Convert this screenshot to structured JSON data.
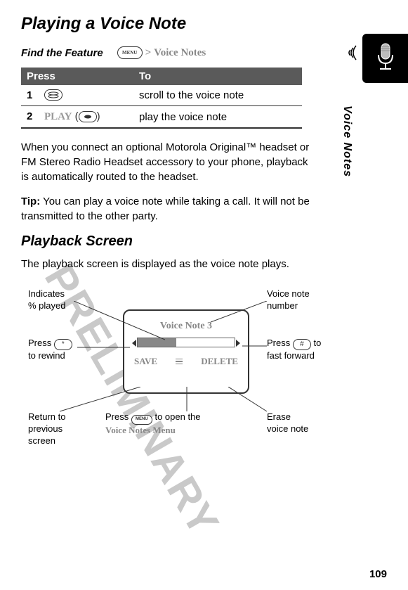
{
  "page": {
    "title": "Playing a Voice Note",
    "findFeature": {
      "label": "Find the Feature",
      "menuKey": "MENU",
      "gt": ">",
      "path": "Voice Notes"
    },
    "table": {
      "headerPress": "Press",
      "headerTo": "To",
      "rows": [
        {
          "num": "1",
          "key": "scroll-key",
          "desc": "scroll to the voice note"
        },
        {
          "num": "2",
          "keyLabel": "PLAY",
          "paren": "(",
          "parenClose": ")",
          "desc": "play the voice note"
        }
      ]
    },
    "para1": "When you connect an optional Motorola Original™ headset or FM Stereo Radio Headset accessory to your phone, playback is automatically routed to the headset.",
    "tip": {
      "label": "Tip:",
      "text": " You can play a voice note while taking a call. It will not be transmitted to the other party."
    },
    "subtitle": "Playback Screen",
    "para2": "The playback screen is displayed as the voice note plays.",
    "screen": {
      "title": "Voice Note 3",
      "save": "SAVE",
      "delete": "DELETE"
    },
    "callouts": {
      "percentPlayed": "Indicates\n% played",
      "voiceNoteNumber": "Voice note\nnumber",
      "rewind1": "Press ",
      "rewind2": "\nto rewind",
      "fastForward1": "Press ",
      "fastForward2": " to\nfast forward",
      "returnPrev": "Return to\nprevious\nscreen",
      "openMenu1": "Press ",
      "openMenu2": " to open the\n",
      "openMenu3": "Voice Notes Menu",
      "erase": "Erase\nvoice note"
    },
    "sideLabel": "Voice Notes",
    "watermark": "PRELIMINARY",
    "pageNumber": "109",
    "keys": {
      "star": "*",
      "hash": "#",
      "menu": "MENU"
    }
  }
}
